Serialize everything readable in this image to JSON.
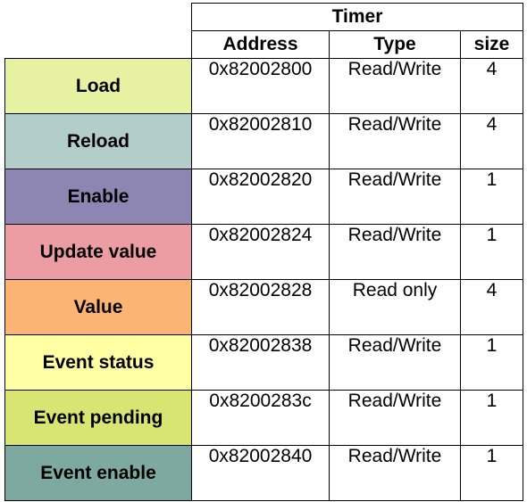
{
  "table": {
    "title": "Timer",
    "headers": {
      "address": "Address",
      "type": "Type",
      "size": "size"
    },
    "rows": [
      {
        "name": "Load",
        "address": "0x82002800",
        "type": "Read/Write",
        "size": "4",
        "color": "#e6f2a2"
      },
      {
        "name": "Reload",
        "address": "0x82002810",
        "type": "Read/Write",
        "size": "4",
        "color": "#b3cdcb"
      },
      {
        "name": "Enable",
        "address": "0x82002820",
        "type": "Read/Write",
        "size": "1",
        "color": "#8d86b3"
      },
      {
        "name": "Update value",
        "address": "0x82002824",
        "type": "Read/Write",
        "size": "1",
        "color": "#ec9ca3"
      },
      {
        "name": "Value",
        "address": "0x82002828",
        "type": "Read only",
        "size": "4",
        "color": "#fcb474"
      },
      {
        "name": "Event status",
        "address": "0x82002838",
        "type": "Read/Write",
        "size": "1",
        "color": "#ffffa4"
      },
      {
        "name": "Event pending",
        "address": "0x8200283c",
        "type": "Read/Write",
        "size": "1",
        "color": "#d9e573"
      },
      {
        "name": "Event enable",
        "address": "0x82002840",
        "type": "Read/Write",
        "size": "1",
        "color": "#7ea9a0"
      }
    ]
  }
}
